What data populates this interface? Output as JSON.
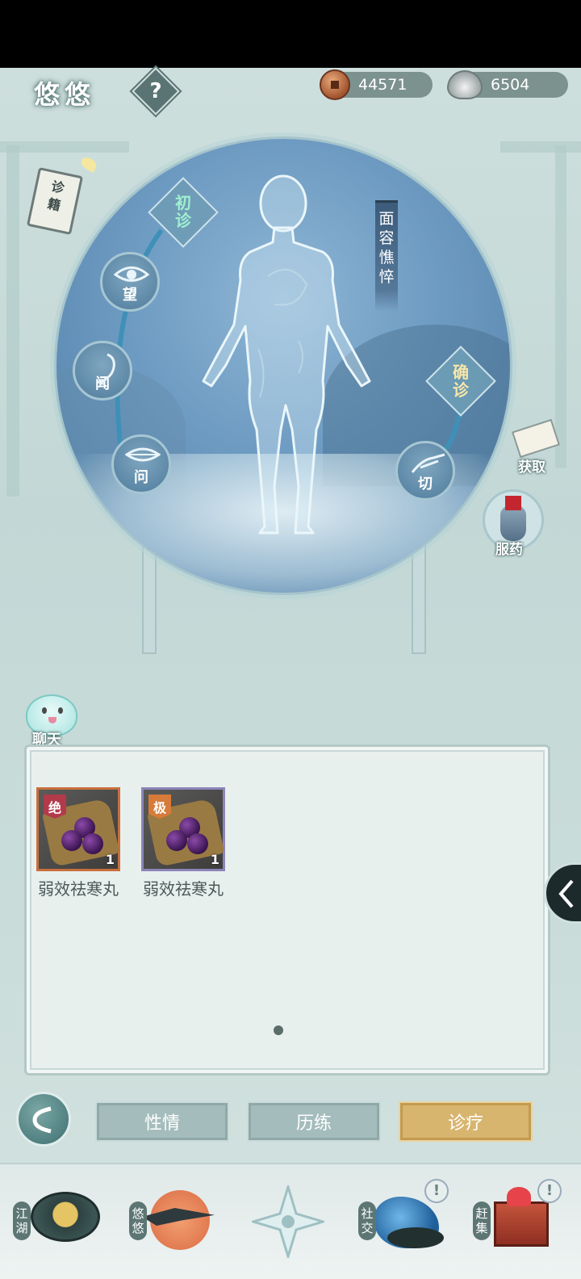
{
  "header": {
    "character_name": "悠悠",
    "help_label": "?",
    "copper_amount": "44571",
    "silver_amount": "6504"
  },
  "diagnosis_book": {
    "label": "诊籍"
  },
  "diagnosis": {
    "stage_initial": "初诊",
    "stage_confirm": "确诊",
    "symptom": "面容憔悴",
    "methods": {
      "look": "望",
      "listen": "闻",
      "ask": "问",
      "pulse": "切"
    }
  },
  "side_actions": {
    "obtain_label": "获取",
    "take_medicine_label": "服药",
    "chat_label": "聊天"
  },
  "inventory": {
    "items": [
      {
        "name": "弱效祛寒丸",
        "tier": "绝",
        "quantity": "1",
        "tier_color": "#b23a4b",
        "frame_color": "#c86f3d"
      },
      {
        "name": "弱效祛寒丸",
        "tier": "极",
        "quantity": "1",
        "tier_color": "#d77b3a",
        "frame_color": "#8c84b8"
      }
    ]
  },
  "tabs": {
    "temperament": "性情",
    "experience": "历练",
    "treatment": "诊疗",
    "active": "诊疗"
  },
  "bottom_nav": {
    "jianghu": "江湖",
    "youyou": "悠悠",
    "social": "社交",
    "market": "赶集",
    "alert_glyph": "!"
  }
}
